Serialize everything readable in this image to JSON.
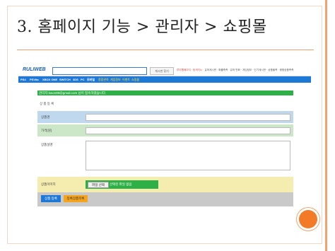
{
  "slide": {
    "title": "3. 홈페이지 기능 > 관리자 > 쇼핑몰"
  },
  "site": {
    "logo": "RULIWEB",
    "search_placeholder": "",
    "search_button": "게시판 찾기",
    "top_links_highlight": "루리웹페이지 · 탐색키노 · ",
    "top_links": "유머게시판 · 확률족족 · 유머 만화 · 게임정보 · 인기게시판 · 상품몰족 · 종합상품족족",
    "nav": [
      "PS4",
      "PSVita",
      "XBOX ONE",
      "SWITCH",
      "3DS",
      "PC",
      "모바일",
      "종합관족",
      "게임정보",
      "이벤트",
      "쇼핑몰"
    ]
  },
  "page": {
    "login_notice": "관리자 kwon99@gmail.com 님이 접속하였습니다.",
    "form_title": "상 품 등 록",
    "fields": {
      "name_label": "상품명",
      "price_label": "가격(원)",
      "desc_label": "상품설명",
      "image_label": "상품이미지"
    },
    "file": {
      "button": "파일 선택",
      "status": "선택된 파일 없음"
    },
    "buttons": {
      "submit": "상품 등록",
      "list": "등록상품목록"
    }
  },
  "colors": {
    "accent_orange": "#f37a27",
    "nav_blue": "#1d78d6",
    "notice_green": "#2db046"
  }
}
